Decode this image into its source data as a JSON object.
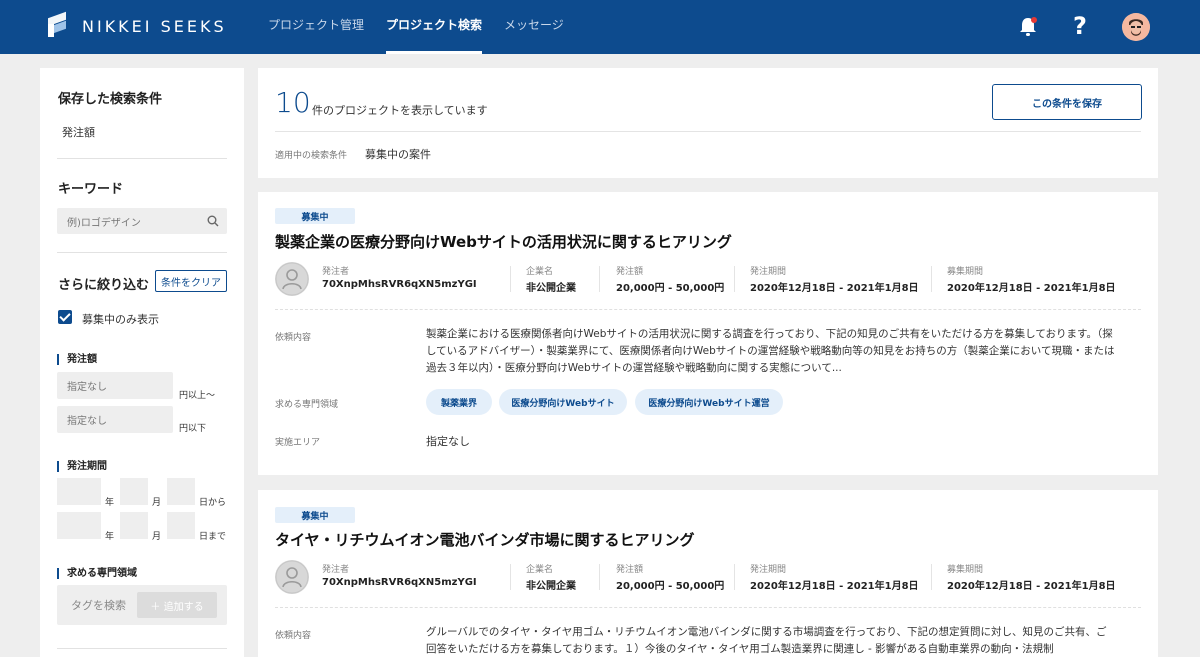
{
  "header": {
    "logo": "NIKKEI SEEKS",
    "nav": [
      {
        "label": "プロジェクト管理"
      },
      {
        "label": "プロジェクト検索"
      },
      {
        "label": "メッセージ"
      }
    ],
    "help": "?",
    "accent": "#0d4b8e"
  },
  "sidebar": {
    "saved_title": "保存した検索条件",
    "saved_item": "発注額",
    "keyword_title": "キーワード",
    "keyword_placeholder": "例)ロゴデザイン",
    "filter_title": "さらに絞り込む",
    "clear_label": "条件をクリア",
    "only_open_label": "募集中のみ表示",
    "amount_title": "発注額",
    "amount_min_placeholder": "指定なし",
    "amount_min_suffix": "円以上〜",
    "amount_max_placeholder": "指定なし",
    "amount_max_suffix": "円以下",
    "period_title": "発注期間",
    "year": "年",
    "month": "月",
    "from": "日から",
    "to": "日まで",
    "field_title": "求める専門領域",
    "tag_placeholder": "タグを検索",
    "add_label": "＋ 追加する"
  },
  "summary": {
    "count": "10",
    "count_text": "件のプロジェクトを表示しています",
    "save_label": "この条件を保存",
    "applied_label": "適用中の検索条件",
    "applied_value": "募集中の案件"
  },
  "cards": [
    {
      "badge": "募集中",
      "title": "製薬企業の医療分野向けWebサイトの活用状況に関するヒアリング",
      "orderer_label": "発注者",
      "orderer": "70XnpMhsRVR6qXN5mzYGI",
      "company_label": "企業名",
      "company": "非公開企業",
      "amount_label": "発注額",
      "amount": "20,000円 - 50,000円",
      "period_label": "発注期間",
      "period": "2020年12月18日 - 2021年1月8日",
      "recruit_label": "募集期間",
      "recruit": "2020年12月18日 - 2021年1月8日",
      "desc_label": "依頼内容",
      "desc": "製薬企業における医療関係者向けWebサイトの活用状況に関する調査を行っており、下記の知見のご共有をいただける方を募集しております。（探しているアドバイザー）・製薬業界にて、医療関係者向けWebサイトの運営経験や戦略動向等の知見をお持ちの方（製薬企業において現職・または過去３年以内）・医療分野向けWebサイトの運営経験や戦略動向に関する実態について...",
      "field_label": "求める専門領域",
      "tags": [
        "製薬業界",
        "医療分野向けWebサイト",
        "医療分野向けWebサイト運営"
      ],
      "area_label": "実施エリア",
      "area": "指定なし"
    },
    {
      "badge": "募集中",
      "title": "タイヤ・リチウムイオン電池バインダ市場に関するヒアリング",
      "orderer_label": "発注者",
      "orderer": "70XnpMhsRVR6qXN5mzYGI",
      "company_label": "企業名",
      "company": "非公開企業",
      "amount_label": "発注額",
      "amount": "20,000円 - 50,000円",
      "period_label": "発注期間",
      "period": "2020年12月18日 - 2021年1月8日",
      "recruit_label": "募集期間",
      "recruit": "2020年12月18日 - 2021年1月8日",
      "desc_label": "依頼内容",
      "desc": "グルーバルでのタイヤ・タイヤ用ゴム・リチウムイオン電池バインダに関する市場調査を行っており、下記の想定質問に対し、知見のご共有、ご回答をいただける方を募集しております。１）今後のタイヤ・タイヤ用ゴム製造業界に関連し - 影響がある自動車業界の動向・法規制"
    }
  ]
}
